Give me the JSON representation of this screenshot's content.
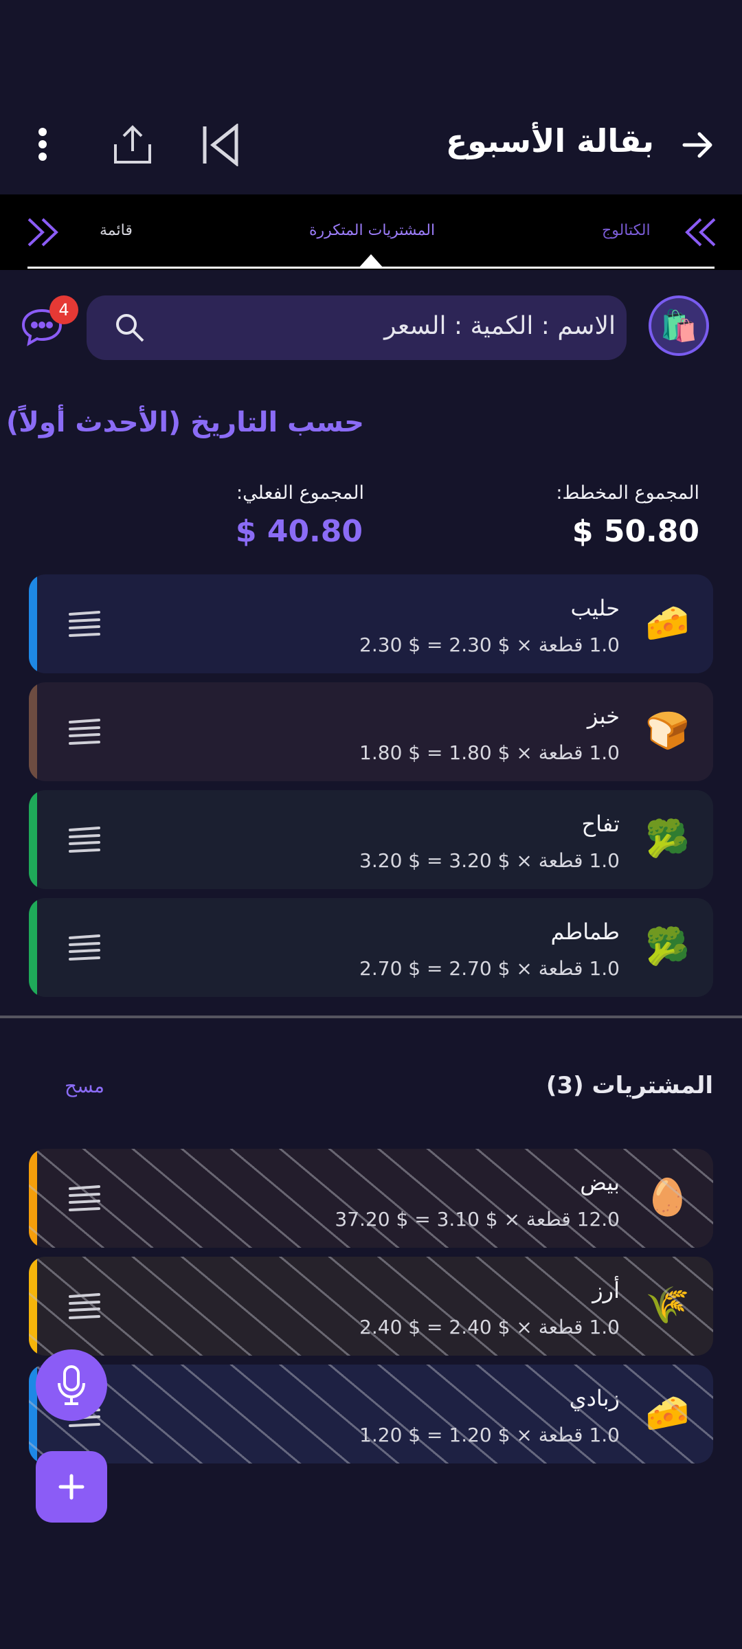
{
  "header": {
    "title": "بقالة الأسبوع",
    "back_icon": "arrow-right-icon",
    "actions": [
      "skip-previous-icon",
      "share-icon",
      "more-vert-icon"
    ]
  },
  "tabs": {
    "left_label": "قائمة",
    "center_label": "المشتريات المتكررة",
    "right_label": "الكتالوج"
  },
  "search": {
    "value": "الاسم : الكمية : السعر",
    "badge_count": "4"
  },
  "sort_title": "حسب التاريخ (الأحدث أولاً)",
  "totals": {
    "planned_label": "المجموع المخطط:",
    "planned_value": "$ 50.80",
    "actual_label": "المجموع الفعلي:",
    "actual_value": "$ 40.80"
  },
  "planned_items": [
    {
      "name": "حليب",
      "detail": "1.0 قطعة × $ 2.30 = $ 2.30",
      "emoji": "🧀",
      "stripe": "#1e88e5",
      "bg": "#1c1e3f"
    },
    {
      "name": "خبز",
      "detail": "1.0 قطعة × $ 1.80 = $ 1.80",
      "emoji": "🍞",
      "stripe": "#6d4c41",
      "bg": "#231d31"
    },
    {
      "name": "تفاح",
      "detail": "1.0 قطعة × $ 3.20 = $ 3.20",
      "emoji": "🥦",
      "stripe": "#1faa59",
      "bg": "#1b1f30"
    },
    {
      "name": "طماطم",
      "detail": "1.0 قطعة × $ 2.70 = $ 2.70",
      "emoji": "🥦",
      "stripe": "#1faa59",
      "bg": "#1b1f30"
    }
  ],
  "purchases": {
    "title": "المشتريات (3)",
    "clear_label": "مسح",
    "items": [
      {
        "name": "بيض",
        "detail": "12.0 قطعة × $ 3.10 = $ 37.20",
        "emoji": "🥚",
        "stripe": "#f59e0b",
        "bg": "#231d2c"
      },
      {
        "name": "أرز",
        "detail": "1.0 قطعة × $ 2.40 = $ 2.40",
        "emoji": "🌾",
        "stripe": "#f5b50b",
        "bg": "#26222b"
      },
      {
        "name": "زبادي",
        "detail": "1.0 قطعة × $ 1.20 = $ 1.20",
        "emoji": "🧀",
        "stripe": "#1e88e5",
        "bg": "#1e2143"
      }
    ]
  },
  "fabs": [
    "microphone-icon",
    "plus-icon"
  ],
  "colors": {
    "accent": "#8b5cf6",
    "background": "#15142a"
  }
}
